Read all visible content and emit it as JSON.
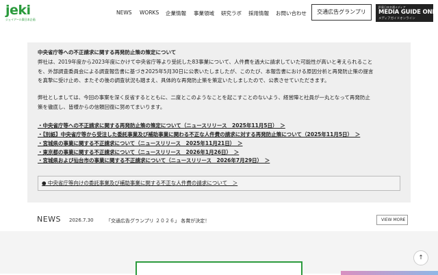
{
  "header": {
    "logo_text": "jeki",
    "logo_sub": "ジェイアール東日本企画",
    "nav": [
      "NEWS",
      "WORKS",
      "企業情報",
      "事業領域",
      "研究ラボ",
      "採用情報",
      "お問い合わせ"
    ],
    "grandprix_button": "交通広告グランプリ",
    "media_guide": {
      "top": "JR東日本交通メディア",
      "main": "MEDIA GUIDE ONLINE",
      "sub": "メディアガイドオンライン"
    }
  },
  "notice": {
    "title": "中央省庁等への不正請求に関する再発防止策の策定について",
    "para1": [
      "弊社は、2019年度から2023年度にかけて中央省庁等より受託した83事業について、人件費を過大に請求していた可能性が高いと考えられること",
      "を、外部調査委員会による調査報告書に基づき2025年5月30日に公表いたしましたが、このたび、本報告書における原因分析と再発防止策の提言",
      "を真摯に受け止め、またその後の調査状況も踏まえ、具体的な再発防止策を策定いたしましたので、公表させていただきます。"
    ],
    "para2": [
      "弊社としましては、今回の事案を深く反省するとともに、二度とこのようなことを起こすことのないよう、経営陣と社員が一丸となって再発防止",
      "策を徹底し、皆様からの信頼回復に努めてまいります。"
    ],
    "links": [
      "・中央省庁等への不正請求に関する再発防止策の策定について（ニュースリリース　2025年11月5日）　＞",
      "・【別紙】中央省庁等から受注した委託事業及び補助事業に関わる不正な人件費の請求に対する再発防止策について（2025年11月5日）　＞",
      "・宮城県の事業に関する不正請求について（ニュースリリース　2025年11月21日）　＞",
      "・東京都の事業に関する不正請求について（ニュースリリース　2026年1月26日）　＞",
      "・宮城県および仙台市の事業に関する不正請求について（ニュースリリース　2026年7月29日）　＞"
    ],
    "inner_link": "● 中央省庁等向けの委託事業及び補助事業に関する不正な人件費の請求について　＞"
  },
  "news": {
    "label": "NEWS",
    "date": "2026.7.30",
    "text": "「交通広告グランプリ ２０２６」 各賞が決定！",
    "view_more": "VIEW MORE",
    "chevron": "›"
  },
  "totop_glyph": "↑",
  "colors": {
    "brand_green": "#2a9a3c",
    "panel_bg": "#efefef"
  }
}
